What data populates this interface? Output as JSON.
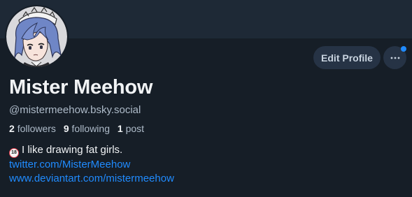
{
  "profile": {
    "display_name": "Mister Meehow",
    "handle": "@mistermeehow.bsky.social",
    "followers_count": "2",
    "followers_label": "followers",
    "following_count": "9",
    "following_label": "following",
    "posts_count": "1",
    "posts_label": "post",
    "bio_text": "I like drawing fat girls.",
    "bio_icon_text": "18",
    "links": [
      "twitter.com/MisterMeehow",
      "www.deviantart.com/mistermeehow"
    ]
  },
  "actions": {
    "edit_profile_label": "Edit Profile"
  },
  "icons": {
    "more": "ellipsis-icon",
    "adult": "no-under-18-icon"
  },
  "colors": {
    "background": "#161e27",
    "banner": "#1e2936",
    "button_bg": "#263345",
    "link": "#208bfe",
    "notification_dot": "#208bfe"
  }
}
